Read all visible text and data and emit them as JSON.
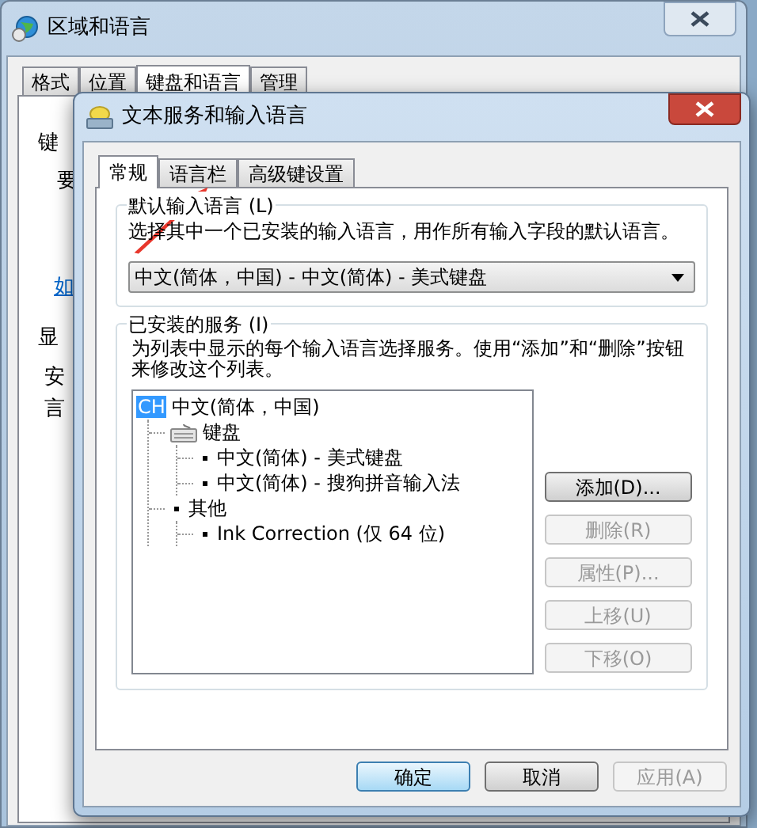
{
  "back_window": {
    "title": "区域和语言",
    "tabs": [
      {
        "label": "格式",
        "selected": false
      },
      {
        "label": "位置",
        "selected": false
      },
      {
        "label": "键盘和语言",
        "selected": true
      },
      {
        "label": "管理",
        "selected": false
      }
    ],
    "fragments": [
      {
        "kind": "group",
        "text": "键"
      },
      {
        "kind": "text",
        "text": "要"
      },
      {
        "kind": "link",
        "text": "如"
      },
      {
        "kind": "group",
        "text": "显"
      },
      {
        "kind": "text",
        "text": "安"
      },
      {
        "kind": "text",
        "text": "言"
      }
    ]
  },
  "dialog": {
    "title": "文本服务和输入语言",
    "tabs": [
      {
        "label": "常规",
        "selected": true
      },
      {
        "label": "语言栏",
        "selected": false
      },
      {
        "label": "高级键设置",
        "selected": false
      }
    ],
    "default_language": {
      "heading": "默认输入语言 (L)",
      "description": "选择其中一个已安装的输入语言，用作所有输入字段的默认语言。",
      "value": "中文(简体，中国) - 中文(简体) - 美式键盘"
    },
    "services": {
      "heading": "已安装的服务 (I)",
      "description": "为列表中显示的每个输入语言选择服务。使用“添加”和“删除”按钮来修改这个列表。",
      "tree": [
        {
          "kind": "language",
          "badge": "CH",
          "label": "中文(简体，中国)",
          "selected": true,
          "children": [
            {
              "kind": "keyboard",
              "label": "键盘",
              "selected": false,
              "children": [
                {
                  "kind": "bullet",
                  "label": "中文(简体) - 美式键盘",
                  "selected": false
                },
                {
                  "kind": "bullet",
                  "label": "中文(简体) - 搜狗拼音输入法",
                  "selected": false
                }
              ]
            },
            {
              "kind": "bullet",
              "label": "其他",
              "selected": false,
              "children": [
                {
                  "kind": "bullet",
                  "label": "Ink Correction (仅 64 位)",
                  "selected": false
                }
              ]
            }
          ]
        }
      ],
      "buttons": [
        {
          "label": "添加(D)...",
          "disabled": false
        },
        {
          "label": "删除(R)",
          "disabled": true
        },
        {
          "label": "属性(P)...",
          "disabled": true
        },
        {
          "label": "上移(U)",
          "disabled": true
        },
        {
          "label": "下移(O)",
          "disabled": true
        }
      ]
    },
    "footer_buttons": [
      {
        "label": "确定",
        "disabled": false,
        "default": true
      },
      {
        "label": "取消",
        "disabled": false,
        "default": false
      },
      {
        "label": "应用(A)",
        "disabled": true,
        "default": false
      }
    ]
  }
}
